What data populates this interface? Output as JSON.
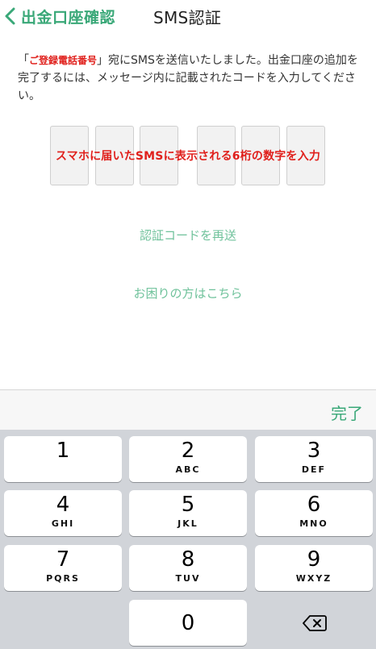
{
  "nav": {
    "back_label": "出金口座確認",
    "title": "SMS認証"
  },
  "message": {
    "quote_open": "「",
    "highlight": "ご登録電話番号",
    "rest": "」宛にSMSを送信いたしました。出金口座の追加を完了するには、メッセージ内に記載されたコードを入力してください。"
  },
  "code": {
    "caption": "スマホに届いたSMSに表示される6桁の数字を入力",
    "slots": [
      "",
      "",
      "",
      "",
      "",
      ""
    ]
  },
  "links": {
    "resend": "認証コードを再送",
    "help": "お困りの方はこちら"
  },
  "keyboard": {
    "done_label": "完了",
    "keys": [
      {
        "num": "1",
        "letters": ""
      },
      {
        "num": "2",
        "letters": "ABC"
      },
      {
        "num": "3",
        "letters": "DEF"
      },
      {
        "num": "4",
        "letters": "GHI"
      },
      {
        "num": "5",
        "letters": "JKL"
      },
      {
        "num": "6",
        "letters": "MNO"
      },
      {
        "num": "7",
        "letters": "PQRS"
      },
      {
        "num": "8",
        "letters": "TUV"
      },
      {
        "num": "9",
        "letters": "WXYZ"
      },
      {
        "num": "0",
        "letters": ""
      }
    ],
    "delete_icon": "backspace-icon"
  },
  "colors": {
    "accent": "#3aa878",
    "link": "#6fc29b",
    "highlight": "#e0201c",
    "keyboard_bg": "#d1d4d9"
  }
}
